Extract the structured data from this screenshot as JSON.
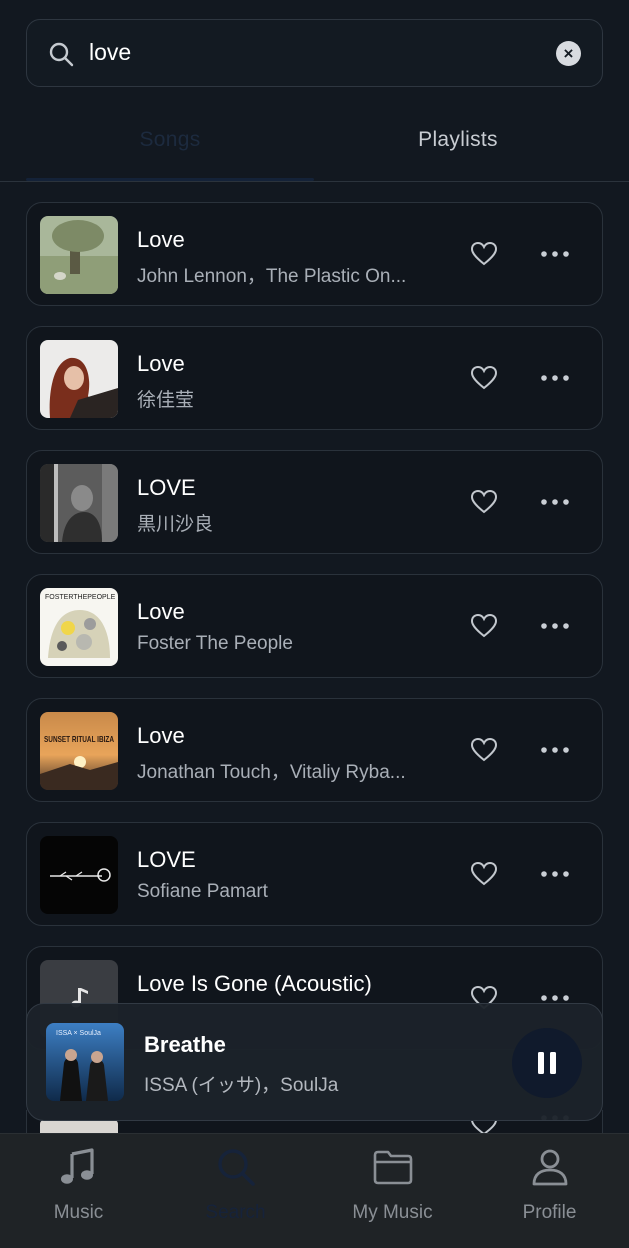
{
  "search": {
    "query": "love"
  },
  "tabs": [
    {
      "label": "Songs",
      "active": true
    },
    {
      "label": "Playlists",
      "active": false
    }
  ],
  "songs": [
    {
      "title": "Love",
      "artist": "John Lennon，The Plastic On..."
    },
    {
      "title": "Love",
      "artist": "徐佳莹"
    },
    {
      "title": "LOVE",
      "artist": "黒川沙良"
    },
    {
      "title": "Love",
      "artist": "Foster The People"
    },
    {
      "title": "Love",
      "artist": "Jonathan Touch，Vitaliy Ryba..."
    },
    {
      "title": "LOVE",
      "artist": "Sofiane Pamart"
    },
    {
      "title": "Love Is Gone (Acoustic)",
      "artist": ""
    }
  ],
  "covers": {
    "foster_text": "FOSTERTHEPEOPLE",
    "sunset_text": "SUNSET RITUAL IBIZA"
  },
  "now_playing": {
    "title": "Breathe",
    "artist": "ISSA (イッサ)，SoulJa",
    "cover_text": "ISSA × SoulJa"
  },
  "nav": [
    {
      "label": "Music",
      "icon": "music-note-icon"
    },
    {
      "label": "Search",
      "icon": "search-icon"
    },
    {
      "label": "My Music",
      "icon": "folder-icon"
    },
    {
      "label": "Profile",
      "icon": "profile-icon"
    }
  ],
  "colors": {
    "background": "#121820",
    "accent_dark": "#16233a",
    "row_bg": "#10151c",
    "row_border": "#2a323b"
  }
}
